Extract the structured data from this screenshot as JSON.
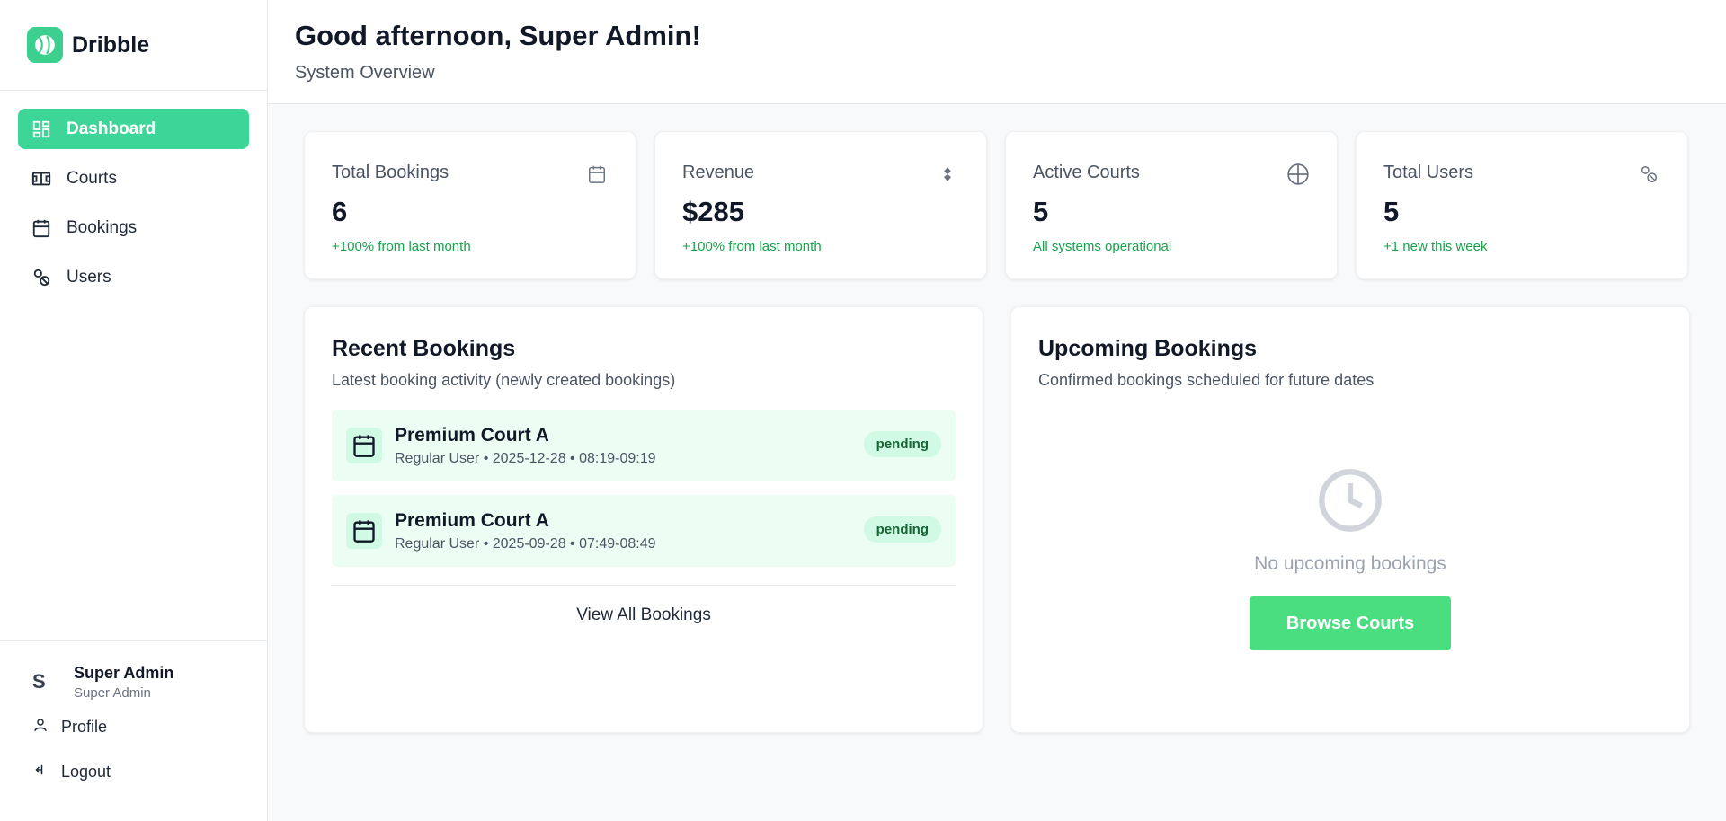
{
  "brand": {
    "name": "Dribble",
    "accent": "#3dd598"
  },
  "nav": {
    "dashboard": "Dashboard",
    "courts": "Courts",
    "bookings": "Bookings",
    "users": "Users"
  },
  "user": {
    "initial": "S",
    "name": "Super Admin",
    "role": "Super Admin"
  },
  "bottom_links": {
    "profile": "Profile",
    "logout": "Logout"
  },
  "header": {
    "greeting": "Good afternoon, Super Admin!",
    "subtitle": "System Overview"
  },
  "stats": [
    {
      "label": "Total Bookings",
      "value": "6",
      "note": "+100% from last month",
      "icon": "calendar-icon"
    },
    {
      "label": "Revenue",
      "value": "$285",
      "note": "+100% from last month",
      "icon": "dollar-icon"
    },
    {
      "label": "Active Courts",
      "value": "5",
      "note": "All systems operational",
      "icon": "court-globe-icon"
    },
    {
      "label": "Total Users",
      "value": "5",
      "note": "+1 new this week",
      "icon": "users-icon"
    }
  ],
  "recent": {
    "title": "Recent Bookings",
    "subtitle": "Latest booking activity (newly created bookings)",
    "items": [
      {
        "court": "Premium Court A",
        "meta": "Regular User • 2025-12-28 • 08:19-09:19",
        "status": "pending"
      },
      {
        "court": "Premium Court A",
        "meta": "Regular User • 2025-09-28 • 07:49-08:49",
        "status": "pending"
      }
    ],
    "view_all": "View All Bookings"
  },
  "upcoming": {
    "title": "Upcoming Bookings",
    "subtitle": "Confirmed bookings scheduled for future dates",
    "empty_text": "No upcoming bookings",
    "button": "Browse Courts"
  }
}
